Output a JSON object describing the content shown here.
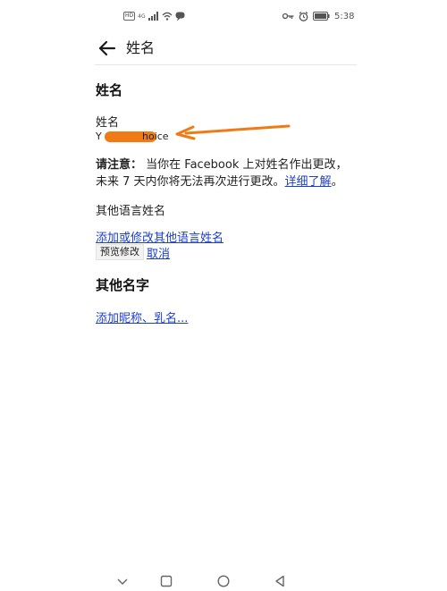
{
  "status_bar": {
    "left_badge": "HD",
    "network": "4G",
    "time": "5:38"
  },
  "header": {
    "title": "姓名"
  },
  "sections": {
    "name_heading": "姓名",
    "other_names_heading": "其他名字"
  },
  "name_field": {
    "label": "姓名",
    "value_start": "Y",
    "value_end": "hoice"
  },
  "notice": {
    "bold_label": "请注意：",
    "text": "当你在 Facebook 上对姓名作出更改，未来 7 天内你将无法再次进行更改。",
    "link": "详细了解",
    "end": "。"
  },
  "other_language": {
    "label": "其他语言姓名",
    "add_link": "添加或修改其他语言姓名",
    "preview_button": "预览修改",
    "cancel_link": "取消"
  },
  "nickname_link": "添加昵称、乳名...",
  "colors": {
    "link": "#1d3fcb",
    "annotation": "#f07b16"
  }
}
